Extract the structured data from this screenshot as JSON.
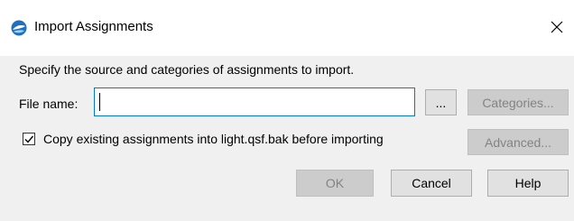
{
  "window": {
    "title": "Import Assignments",
    "close_icon": "close-icon",
    "app_icon": "app-globe-icon"
  },
  "form": {
    "description": "Specify the source and categories of assignments to import.",
    "file_name_label": "File name:",
    "file_name_value": "",
    "browse_label": "...",
    "categories_label": "Categories...",
    "copy_checkbox_label": "Copy existing assignments into light.qsf.bak before importing",
    "copy_checkbox_checked": true,
    "advanced_label": "Advanced..."
  },
  "footer": {
    "ok_label": "OK",
    "cancel_label": "Cancel",
    "help_label": "Help"
  },
  "colors": {
    "input_focus_border": "#0078d7",
    "disabled_text": "#838383",
    "dialog_bg": "#f0f0f0"
  }
}
